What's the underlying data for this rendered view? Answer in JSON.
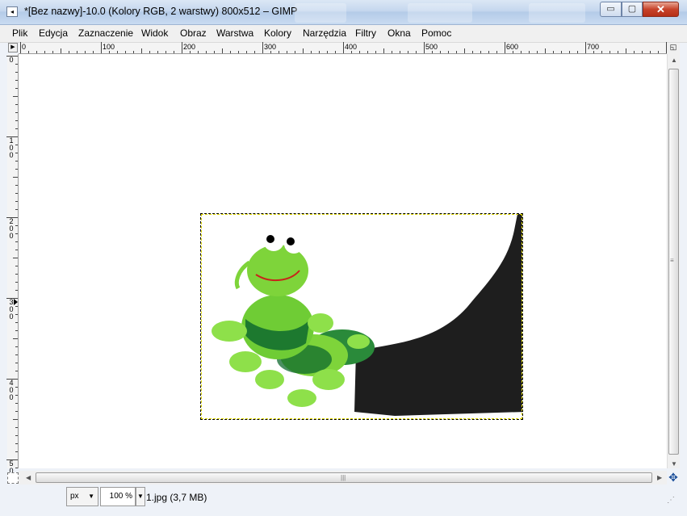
{
  "window": {
    "title": "*[Bez nazwy]-10.0 (Kolory RGB, 2 warstwy) 800x512 – GIMP",
    "minimize_symbol": "▭",
    "maximize_symbol": "▢",
    "close_symbol": "✕"
  },
  "menu": [
    {
      "label": "Plik"
    },
    {
      "label": "Edycja"
    },
    {
      "label": "Zaznaczenie"
    },
    {
      "label": "Widok"
    },
    {
      "label": "Obraz"
    },
    {
      "label": "Warstwa"
    },
    {
      "label": "Kolory"
    },
    {
      "label": "Narzędzia"
    },
    {
      "label": "Filtry"
    },
    {
      "label": "Okna"
    },
    {
      "label": "Pomoc"
    }
  ],
  "ruler": {
    "horizontal_labels": [
      "0",
      "100",
      "200",
      "300",
      "400",
      "500",
      "600",
      "700"
    ],
    "vertical_labels": [
      "0",
      "100",
      "200",
      "300",
      "400",
      "500"
    ]
  },
  "canvas": {
    "image_width": 800,
    "image_height": 512,
    "layer_size": "400x256",
    "content": "green caterpillar plush on black arm"
  },
  "statusbar": {
    "unit": "px",
    "zoom": "100 %",
    "file_info": "1.jpg (3,7 MB)"
  },
  "colors": {
    "titlebar": "#c5d7ee",
    "close_button": "#c7432b",
    "canvas_bg": "#ffffff",
    "selection_border": "#e0d800",
    "arm": "#1e1e1e",
    "caterpillar_light": "#7ed43a",
    "caterpillar_dark": "#0f6a2e"
  }
}
